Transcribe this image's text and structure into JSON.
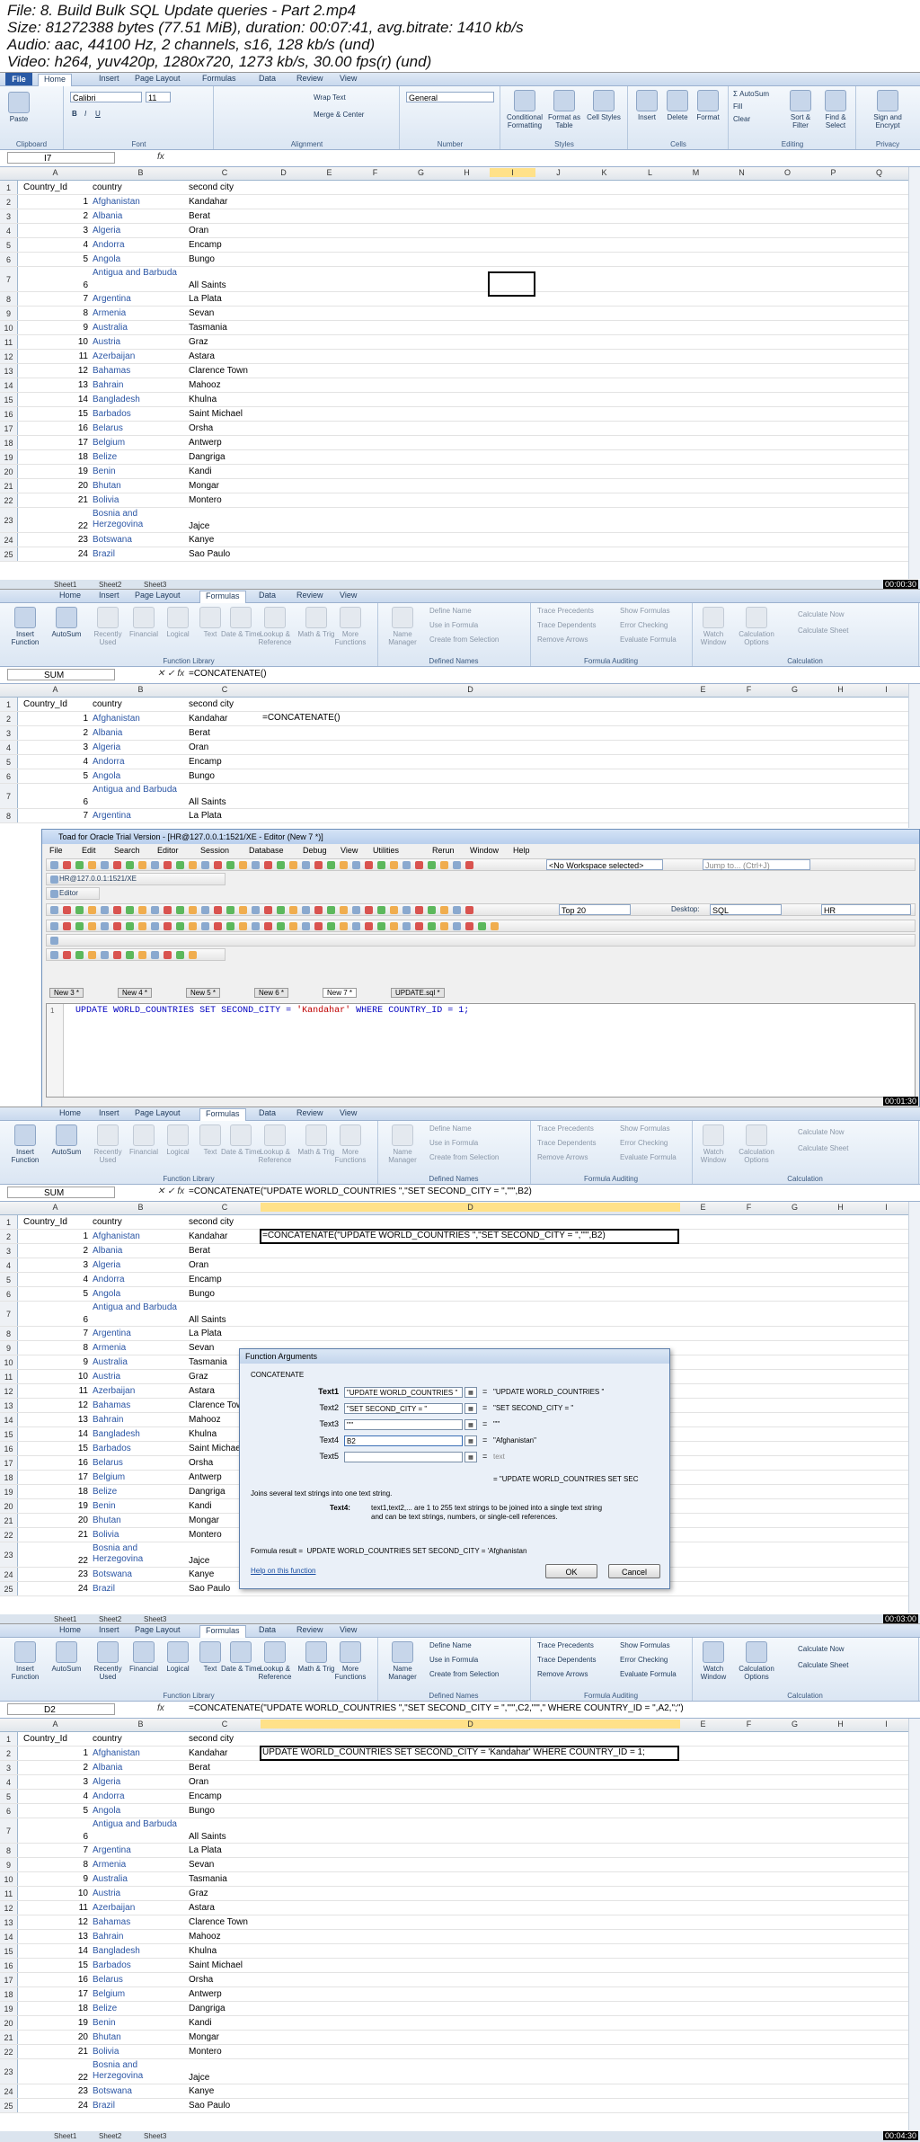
{
  "file_info": {
    "line1": "File: 8. Build Bulk SQL Update queries - Part 2.mp4",
    "line2": "Size: 81272388 bytes (77.51 MiB), duration: 00:07:41, avg.bitrate: 1410 kb/s",
    "line3": "Audio: aac, 44100 Hz, 2 channels, s16, 128 kb/s (und)",
    "line4": "Video: h264, yuv420p, 1280x720, 1273 kb/s, 30.00 fps(r) (und)"
  },
  "timestamps": [
    "00:00:30",
    "00:01:30",
    "00:03:00",
    "00:04:30"
  ],
  "ribbon_tabs": [
    "File",
    "Home",
    "Insert",
    "Page Layout",
    "Formulas",
    "Data",
    "Review",
    "View"
  ],
  "home_ribbon": {
    "clipboard": "Clipboard",
    "paste": "Paste",
    "font_name": "Calibri",
    "font_size": "11",
    "font": "Font",
    "wrap_text": "Wrap Text",
    "merge_center": "Merge & Center",
    "alignment": "Alignment",
    "number_format": "General",
    "number": "Number",
    "conditional_formatting": "Conditional Formatting",
    "format_as_table": "Format as Table",
    "cell_styles": "Cell Styles",
    "styles": "Styles",
    "insert": "Insert",
    "delete": "Delete",
    "format": "Format",
    "cells": "Cells",
    "autosum": "AutoSum",
    "fill": "Fill",
    "clear": "Clear",
    "sort_filter": "Sort & Filter",
    "find_select": "Find & Select",
    "editing": "Editing",
    "sign_encrypt": "Sign and Encrypt",
    "privacy": "Privacy"
  },
  "formulas_ribbon": {
    "insert_function": "Insert Function",
    "autosum": "AutoSum",
    "recently_used": "Recently Used",
    "financial": "Financial",
    "logical": "Logical",
    "text": "Text",
    "date_time": "Date & Time",
    "lookup_reference": "Lookup & Reference",
    "math_trig": "Math & Trig",
    "more_functions": "More Functions",
    "function_library": "Function Library",
    "name_manager": "Name Manager",
    "define_name": "Define Name",
    "use_in_formula": "Use in Formula",
    "create_from_selection": "Create from Selection",
    "defined_names": "Defined Names",
    "trace_precedents": "Trace Precedents",
    "trace_dependents": "Trace Dependents",
    "remove_arrows": "Remove Arrows",
    "show_formulas": "Show Formulas",
    "error_checking": "Error Checking",
    "evaluate_formula": "Evaluate Formula",
    "formula_auditing": "Formula Auditing",
    "watch_window": "Watch Window",
    "calculation_options": "Calculation Options",
    "calculate_now": "Calculate Now",
    "calculate_sheet": "Calculate Sheet",
    "calculation": "Calculation"
  },
  "formula_bar": {
    "f1_name": "I7",
    "f1_formula": "",
    "f2_name": "SUM",
    "f2_formula": "=CONCATENATE()",
    "f3_name": "SUM",
    "f3_formula": "=CONCATENATE(\"UPDATE WORLD_COUNTRIES \",\"SET SECOND_CITY = \",\"'\",B2)",
    "f4_name": "D2",
    "f4_formula": "=CONCATENATE(\"UPDATE WORLD_COUNTRIES \",\"SET SECOND_CITY = \",\"'\",C2,\"'\",\" WHERE COUNTRY_ID = \",A2,\";\")"
  },
  "columns_f1": [
    "A",
    "B",
    "C",
    "D",
    "E",
    "F",
    "G",
    "H",
    "I",
    "J",
    "K",
    "L",
    "M",
    "N",
    "O",
    "P",
    "Q"
  ],
  "columns_f2": [
    "A",
    "B",
    "C",
    "D",
    "E",
    "F",
    "G",
    "H",
    "I"
  ],
  "header_row": {
    "a": "Country_Id",
    "b": "country",
    "c": "second city"
  },
  "rows": [
    {
      "a": "1",
      "b": "Afghanistan",
      "c": "Kandahar"
    },
    {
      "a": "2",
      "b": "Albania",
      "c": "Berat"
    },
    {
      "a": "3",
      "b": "Algeria",
      "c": "Oran"
    },
    {
      "a": "4",
      "b": "Andorra",
      "c": "Encamp"
    },
    {
      "a": "5",
      "b": "Angola",
      "c": "Bungo"
    },
    {
      "a": "6",
      "b": "Antigua and Barbuda",
      "c": "All Saints"
    },
    {
      "a": "7",
      "b": "Argentina",
      "c": "La Plata"
    },
    {
      "a": "8",
      "b": "Armenia",
      "c": "Sevan"
    },
    {
      "a": "9",
      "b": "Australia",
      "c": "Tasmania"
    },
    {
      "a": "10",
      "b": "Austria",
      "c": "Graz"
    },
    {
      "a": "11",
      "b": "Azerbaijan",
      "c": "Astara"
    },
    {
      "a": "12",
      "b": "Bahamas",
      "c": "Clarence Town"
    },
    {
      "a": "13",
      "b": "Bahrain",
      "c": "Mahooz"
    },
    {
      "a": "14",
      "b": "Bangladesh",
      "c": "Khulna"
    },
    {
      "a": "15",
      "b": "Barbados",
      "c": "Saint Michael"
    },
    {
      "a": "16",
      "b": "Belarus",
      "c": "Orsha"
    },
    {
      "a": "17",
      "b": "Belgium",
      "c": "Antwerp"
    },
    {
      "a": "18",
      "b": "Belize",
      "c": "Dangriga"
    },
    {
      "a": "19",
      "b": "Benin",
      "c": "Kandi"
    },
    {
      "a": "20",
      "b": "Bhutan",
      "c": "Mongar"
    },
    {
      "a": "21",
      "b": "Bolivia",
      "c": "Montero"
    },
    {
      "a": "22",
      "b": "Bosnia and Herzegovina",
      "c": "Jajce"
    },
    {
      "a": "23",
      "b": "Botswana",
      "c": "Kanye"
    },
    {
      "a": "24",
      "b": "Brazil",
      "c": "Sao Paulo"
    }
  ],
  "row_numbers": [
    "1",
    "2",
    "3",
    "4",
    "5",
    "6",
    "7",
    "8",
    "9",
    "10",
    "11",
    "12",
    "13",
    "14",
    "15",
    "16",
    "17",
    "18",
    "19",
    "20",
    "21",
    "22",
    "23",
    "24",
    "25"
  ],
  "sheet_tabs": [
    "Sheet1",
    "Sheet2",
    "Sheet3"
  ],
  "f2_cell_d2": "=CONCATENATE()",
  "f3_cell_d2": "=CONCATENATE(\"UPDATE WORLD_COUNTRIES \",\"SET SECOND_CITY = \",\"'\",B2)",
  "f4_cell_d2": "UPDATE WORLD_COUNTRIES SET SECOND_CITY = 'Kandahar' WHERE COUNTRY_ID = 1;",
  "toad": {
    "title": "Toad for Oracle Trial Version - [HR@127.0.0.1:1521/XE - Editor (New 7 *)]",
    "menu": [
      "File",
      "Edit",
      "Search",
      "Editor",
      "Session",
      "Database",
      "Debug",
      "View",
      "Utilities",
      "Rerun",
      "Window",
      "Help"
    ],
    "workspace": "<No Workspace selected>",
    "jump_to": "Jump to... (Ctrl+J)",
    "connection": "HR@127.0.0.1:1521/XE",
    "editor_tab": "Editor",
    "top_rows": "Top 20",
    "desktop_label": "Desktop:",
    "desktop_value": "SQL",
    "schema": "HR",
    "doc_tabs": [
      "New 3 *",
      "New 4 *",
      "New 5 *",
      "New 6 *",
      "New 7 *",
      "UPDATE.sql *"
    ],
    "line_no": "1",
    "sql_kw1": "UPDATE",
    "sql_table": "WORLD_COUNTRIES",
    "sql_kw2": "SET",
    "sql_col": "SECOND_CITY =",
    "sql_str": "'Kandahar'",
    "sql_kw3": "WHERE",
    "sql_tail": "COUNTRY_ID = 1;"
  },
  "dialog": {
    "title": "Function Arguments",
    "function": "CONCATENATE",
    "labels": [
      "Text1",
      "Text2",
      "Text3",
      "Text4",
      "Text5"
    ],
    "inputs": [
      "\"UPDATE WORLD_COUNTRIES \"",
      "\"SET SECOND_CITY = \"",
      "\"'\"",
      "B2",
      ""
    ],
    "values": [
      "\"UPDATE WORLD_COUNTRIES \"",
      "\"SET SECOND_CITY = \"",
      "\"'\"",
      "\"Afghanistan\"",
      "text"
    ],
    "eq": "=",
    "preview": "\"UPDATE WORLD_COUNTRIES SET SEC",
    "description": "Joins several text strings into one text string.",
    "arg_name": "Text4:",
    "arg_help1": "text1,text2,... are 1 to 255 text strings to be joined into a single text string",
    "arg_help2": "and can be text strings, numbers, or single-cell references.",
    "result_label": "Formula result =",
    "result_value": "UPDATE WORLD_COUNTRIES SET SECOND_CITY = 'Afghanistan",
    "help_link": "Help on this function",
    "ok": "OK",
    "cancel": "Cancel"
  }
}
